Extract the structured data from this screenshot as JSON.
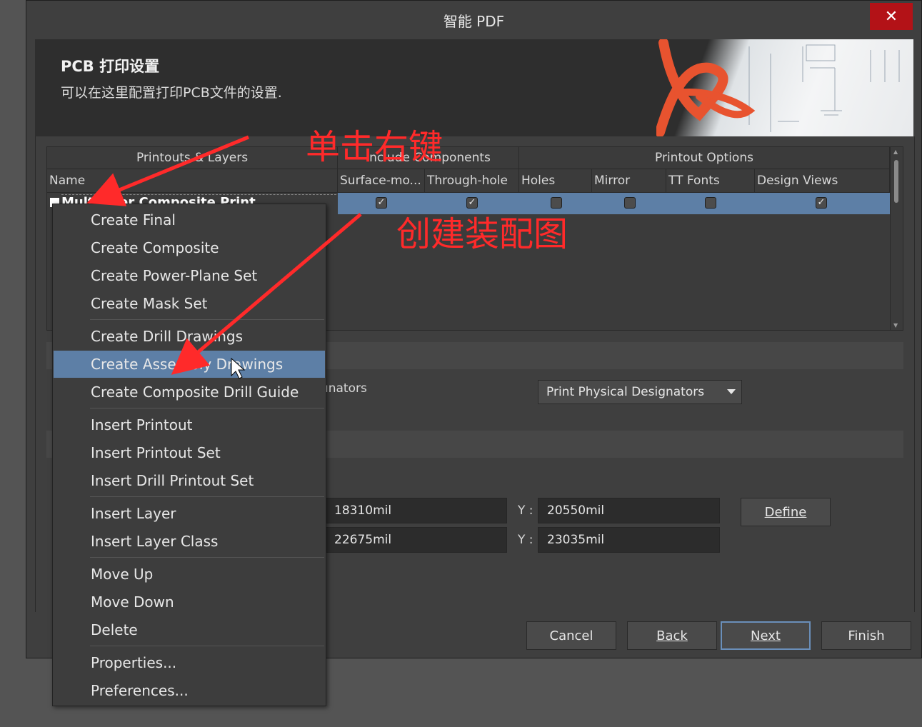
{
  "window": {
    "title": "智能 PDF",
    "close_glyph": "✕"
  },
  "header": {
    "title": "PCB 打印设置",
    "description": "可以在这里配置打印PCB文件的设置."
  },
  "grid": {
    "groups": [
      "Printouts & Layers",
      "Include Components",
      "Printout Options"
    ],
    "columns": [
      "Name",
      "Surface-mo...",
      "Through-hole",
      "Holes",
      "Mirror",
      "TT Fonts",
      "Design Views"
    ],
    "row": {
      "name": "Multilayer Composite Print",
      "checks": [
        true,
        true,
        false,
        false,
        false,
        true
      ]
    }
  },
  "designators": {
    "label_partial": "ınators",
    "select_value": "Print Physical Designators"
  },
  "area": {
    "row1": {
      "x": "18310mil",
      "y_label": "Y :",
      "y": "20550mil"
    },
    "row2": {
      "x": "22675mil",
      "y_label": "Y :",
      "y": "23035mil"
    },
    "define_label": "Define"
  },
  "footer": {
    "cancel": "Cancel",
    "back": "Back",
    "next": "Next",
    "finish": "Finish"
  },
  "context_menu": {
    "items": [
      {
        "label": "Create Final"
      },
      {
        "label": "Create Composite"
      },
      {
        "label": "Create Power-Plane Set"
      },
      {
        "label": "Create Mask Set"
      },
      {
        "label": "Create Drill Drawings"
      },
      {
        "label": "Create Assembly Drawings",
        "highlighted": true
      },
      {
        "label": "Create Composite Drill Guide"
      },
      {
        "label": "Insert Printout"
      },
      {
        "label": "Insert Printout Set"
      },
      {
        "label": "Insert Drill Printout Set"
      },
      {
        "label": "Insert Layer"
      },
      {
        "label": "Insert Layer Class"
      },
      {
        "label": "Move Up"
      },
      {
        "label": "Move Down"
      },
      {
        "label": "Delete"
      },
      {
        "label": "Properties..."
      },
      {
        "label": "Preferences..."
      }
    ]
  },
  "annotations": {
    "right_click": "单击右键",
    "create_assembly": "创建装配图",
    "color": "#ff2a2a"
  }
}
